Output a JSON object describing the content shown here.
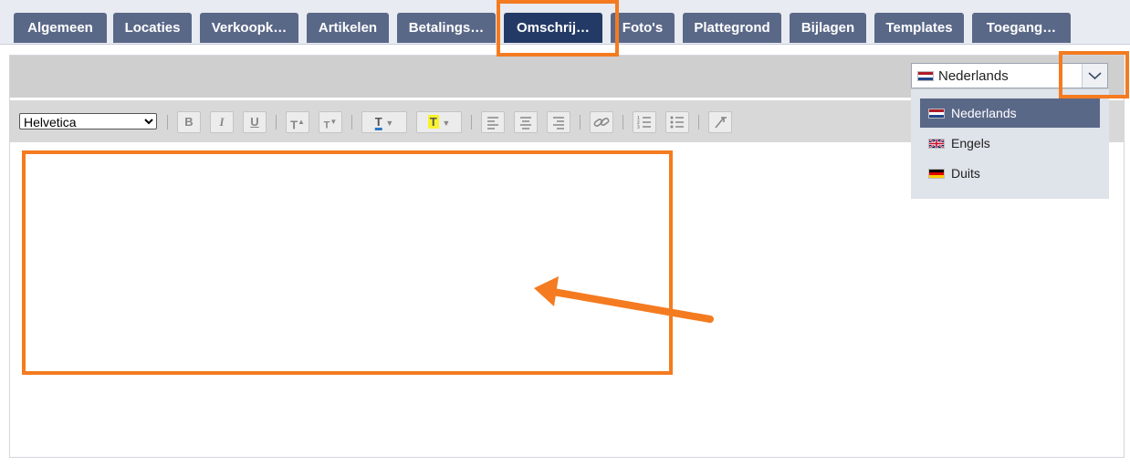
{
  "tabs": [
    {
      "label": "Algemeen"
    },
    {
      "label": "Locaties"
    },
    {
      "label": "Verkoopk…"
    },
    {
      "label": "Artikelen"
    },
    {
      "label": "Betalings…"
    },
    {
      "label": "Omschrij…",
      "active": true
    },
    {
      "label": "Foto's"
    },
    {
      "label": "Plattegrond"
    },
    {
      "label": "Bijlagen"
    },
    {
      "label": "Templates"
    },
    {
      "label": "Toegang…"
    }
  ],
  "language_select": {
    "value": "Nederlands"
  },
  "language_options": [
    {
      "label": "Nederlands",
      "selected": true
    },
    {
      "label": "Engels"
    },
    {
      "label": "Duits"
    }
  ],
  "toolbar": {
    "font_family": "Helvetica",
    "buttons": [
      "bold-icon",
      "italic-icon",
      "underline-icon",
      "superscript-icon",
      "subscript-icon",
      "text-color-icon",
      "highlight-icon",
      "align-left-icon",
      "align-center-icon",
      "align-right-icon",
      "link-icon",
      "ordered-list-icon",
      "unordered-list-icon",
      "clear-format-icon"
    ]
  },
  "colors": {
    "tab_bg": "#5a6888",
    "tab_active_bg": "#243a66",
    "annotation": "#f47b20",
    "text_color_underline": "#2b79c2",
    "highlight_yellow": "#f7f32c"
  }
}
